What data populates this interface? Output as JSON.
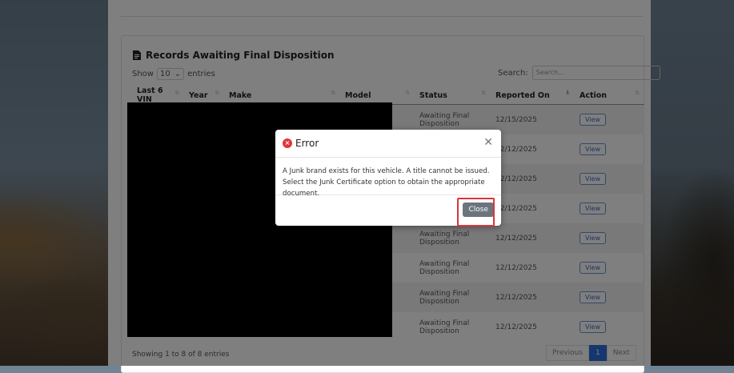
{
  "card": {
    "title": "Records Awaiting Final Disposition"
  },
  "length": {
    "show": "Show",
    "value": "10",
    "entries": "entries"
  },
  "search": {
    "label": "Search:",
    "placeholder": "Search..."
  },
  "table": {
    "columns": [
      "Last 6 VIN",
      "Year",
      "Make",
      "Model",
      "Status",
      "Reported On",
      "Action"
    ],
    "rows": [
      {
        "status": "Awaiting Final Disposition",
        "reported": "12/15/2025",
        "action": "View"
      },
      {
        "status": "",
        "reported": "12/12/2025",
        "action": "View"
      },
      {
        "status": "",
        "reported": "12/12/2025",
        "action": "View"
      },
      {
        "status": "",
        "reported": "12/12/2025",
        "action": "View"
      },
      {
        "status": "Awaiting Final Disposition",
        "reported": "12/12/2025",
        "action": "View"
      },
      {
        "status": "Awaiting Final Disposition",
        "reported": "12/12/2025",
        "action": "View"
      },
      {
        "status": "Awaiting Final Disposition",
        "reported": "12/12/2025",
        "action": "View"
      },
      {
        "status": "Awaiting Final Disposition",
        "reported": "12/12/2025",
        "action": "View"
      }
    ]
  },
  "footer": {
    "info": "Showing 1 to 8 of 8 entries"
  },
  "pager": {
    "previous": "Previous",
    "page": "1",
    "next": "Next"
  },
  "modal": {
    "title": "Error",
    "message": "A Junk brand exists for this vehicle. A title cannot be issued. Select the Junk Certificate option to obtain the appropriate document.",
    "close_label": "Close"
  }
}
